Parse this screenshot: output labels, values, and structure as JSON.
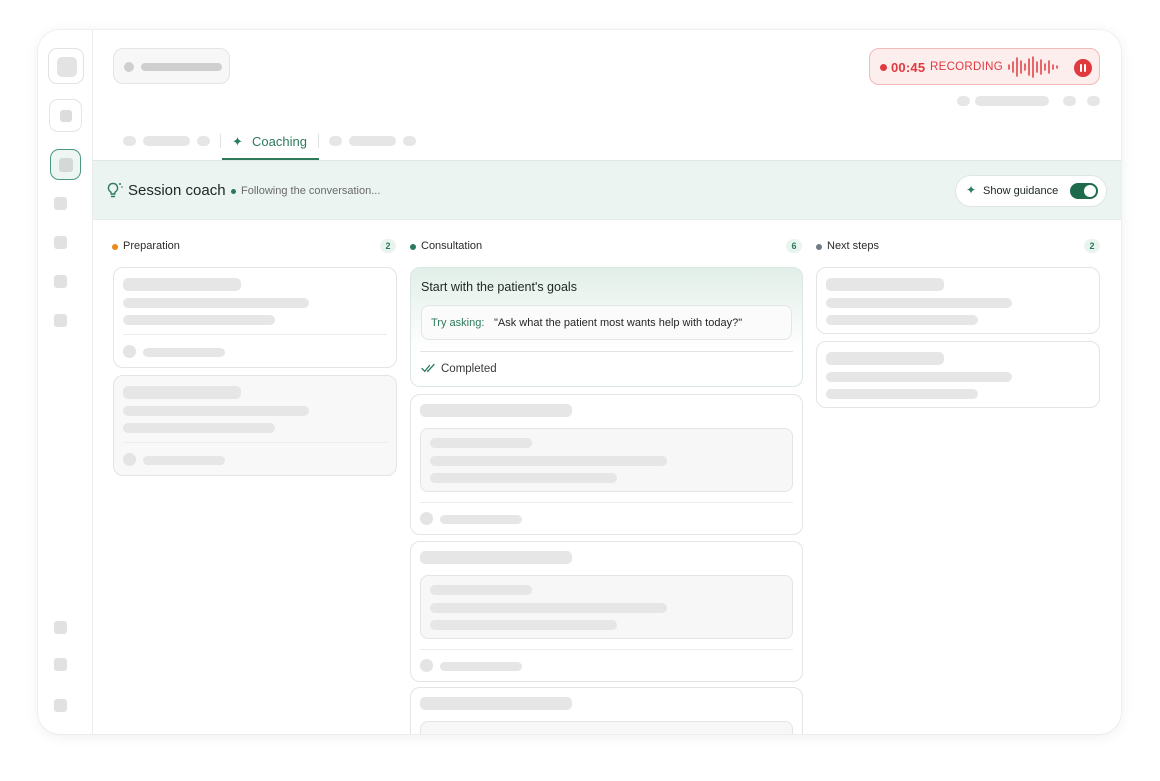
{
  "recording": {
    "time": "00:45",
    "label": "RECORDING",
    "accent": "#e0393e"
  },
  "tabs": {
    "active_label": "Coaching"
  },
  "coach": {
    "title": "Session coach",
    "status": "Following the conversation...",
    "guidance_label": "Show guidance",
    "guidance_on": true,
    "accent": "#2c7a5b"
  },
  "columns": [
    {
      "label": "Preparation",
      "count": "2",
      "dot_color": "#e8891c"
    },
    {
      "label": "Consultation",
      "count": "6",
      "dot_color": "#2c7a5b"
    },
    {
      "label": "Next steps",
      "count": "2",
      "dot_color": "#6e7a86"
    }
  ],
  "featured_card": {
    "title": "Start with the patient's goals",
    "try_label": "Try asking:",
    "try_text": "\"Ask what the patient most wants help with today?\"",
    "status": "Completed"
  },
  "icons": {
    "sparkle": "sparkle-icon",
    "bulb": "lightbulb-icon",
    "check": "double-check-icon",
    "wave": "waveform-icon",
    "pause": "pause-icon"
  }
}
